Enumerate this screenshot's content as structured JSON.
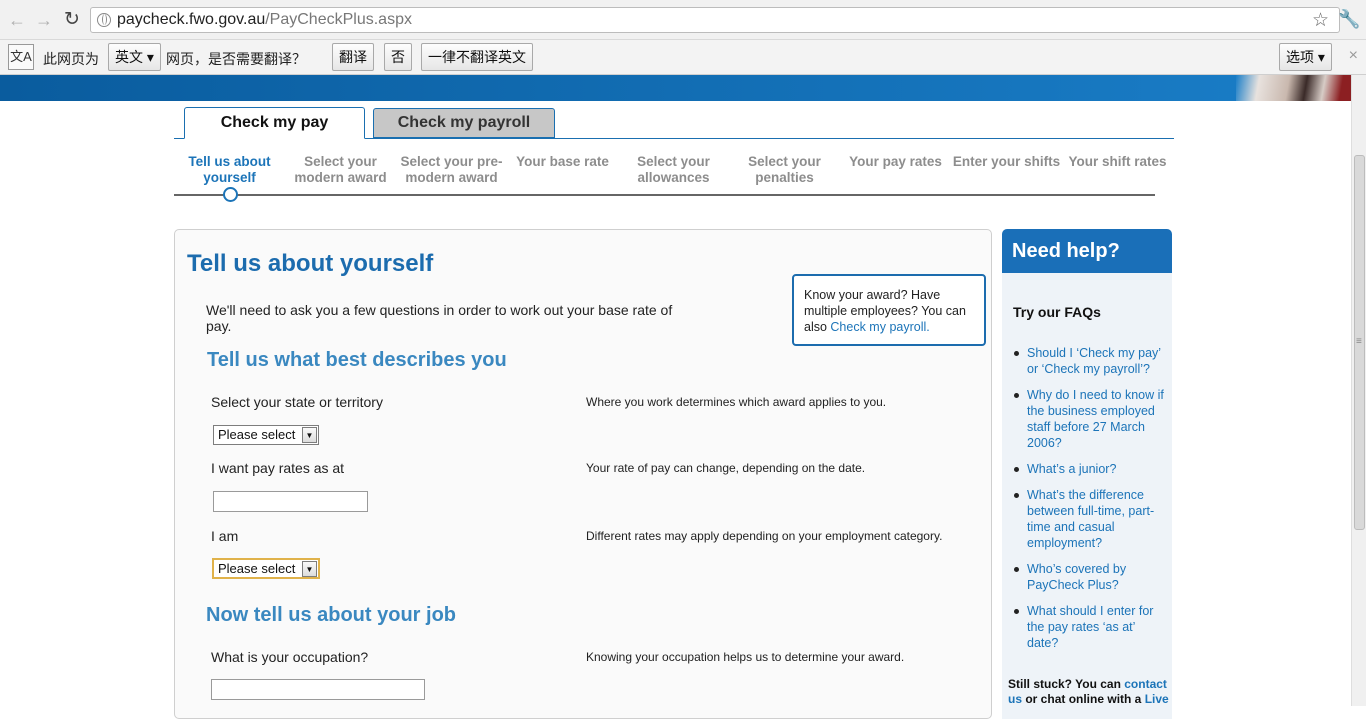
{
  "browser": {
    "url_host": "paycheck.fwo.gov.au",
    "url_path": "/PayCheckPlus.aspx"
  },
  "translate_bar": {
    "prefix": "此网页为",
    "language": "英文",
    "suffix": "网页，是否需要翻译？",
    "translate_button": "翻译",
    "no_button": "否",
    "never_button": "一律不翻译英文",
    "options_button": "选项",
    "close": "×"
  },
  "tabs": [
    {
      "label": "Check my pay",
      "active": true
    },
    {
      "label": "Check my payroll",
      "active": false
    }
  ],
  "steps": [
    {
      "label": "Tell us about yourself",
      "current": true
    },
    {
      "label": "Select your modern award",
      "current": false
    },
    {
      "label": "Select your pre-modern award",
      "current": false
    },
    {
      "label": "Your base rate",
      "current": false
    },
    {
      "label": "Select your allowances",
      "current": false
    },
    {
      "label": "Select your penalties",
      "current": false
    },
    {
      "label": "Your pay rates",
      "current": false
    },
    {
      "label": "Enter your shifts",
      "current": false
    },
    {
      "label": "Your shift rates",
      "current": false
    }
  ],
  "main": {
    "title": "Tell us about yourself",
    "intro": "We'll need to ask you a few questions in order to work out your base rate of pay.",
    "award_box": {
      "text": "Know your award? Have multiple employees? You can also ",
      "link": "Check my payroll."
    },
    "section1_title": "Tell us what best describes you",
    "section2_title": "Now tell us about your job",
    "questions": {
      "state": {
        "label": "Select your state or territory",
        "hint": "Where you work determines which award applies to you.",
        "value": "Please select"
      },
      "date": {
        "label": "I want pay rates as at",
        "hint": "Your rate of pay can change, depending on the date.",
        "value": ""
      },
      "category": {
        "label": "I am",
        "hint": "Different rates may apply depending on your employment category.",
        "value": "Please select"
      },
      "occupation": {
        "label": "What is your occupation?",
        "hint": "Knowing your occupation helps us to determine your award.",
        "value": ""
      }
    }
  },
  "help": {
    "title": "Need help?",
    "faq_heading": "Try our FAQs",
    "faqs": [
      "Should I ‘Check my pay’ or ‘Check my payroll’?",
      "Why do I need to know if the business employed staff before 27 March 2006?",
      "What’s a junior?",
      "What’s the difference between full-time, part-time and casual employment?",
      "Who’s covered by PayCheck Plus?",
      "What should I enter for the pay rates ‘as at’ date?"
    ],
    "stuck_text": "Still stuck? You can ",
    "stuck_link1": "contact us",
    "stuck_mid": " or chat online with a ",
    "stuck_link2": "Live"
  },
  "colors": {
    "brand_blue": "#1c6cae",
    "link_blue": "#1c74b8",
    "help_header": "#1a6fb8"
  }
}
